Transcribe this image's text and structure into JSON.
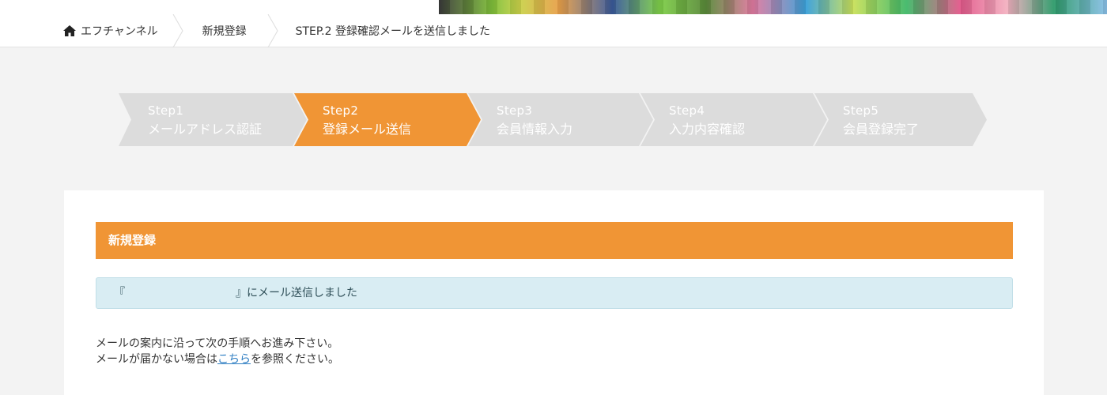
{
  "breadcrumb": {
    "home": "エフチャンネル",
    "middle": "新規登録",
    "current": "STEP.2 登録確認メールを送信しました"
  },
  "steps": [
    {
      "num": "Step1",
      "name": "メールアドレス認証",
      "state": "done"
    },
    {
      "num": "Step2",
      "name": "登録メール送信",
      "state": "active"
    },
    {
      "num": "Step3",
      "name": "会員情報入力",
      "state": "pending"
    },
    {
      "num": "Step4",
      "name": "入力内容確認",
      "state": "pending"
    },
    {
      "num": "Step5",
      "name": "会員登録完了",
      "state": "pending"
    }
  ],
  "panel": {
    "title": "新規登録"
  },
  "alert": {
    "open_bracket": "『",
    "close_text": "』にメール送信しました"
  },
  "instructions": {
    "line1": "メールの案内に沿って次の手順へお進み下さい。",
    "line2_before": "メールが届かない場合は",
    "line2_link": "こちら",
    "line2_after": "を参照ください。"
  },
  "colors": {
    "accent": "#f09535",
    "step_inactive": "#dcdcdc",
    "alert_bg": "#d9edf3",
    "link": "#2d7dc2",
    "page_bg": "#f3f3f3"
  },
  "icons": {
    "home": "home-icon",
    "crumb_separator": "chevron-right-icon"
  }
}
